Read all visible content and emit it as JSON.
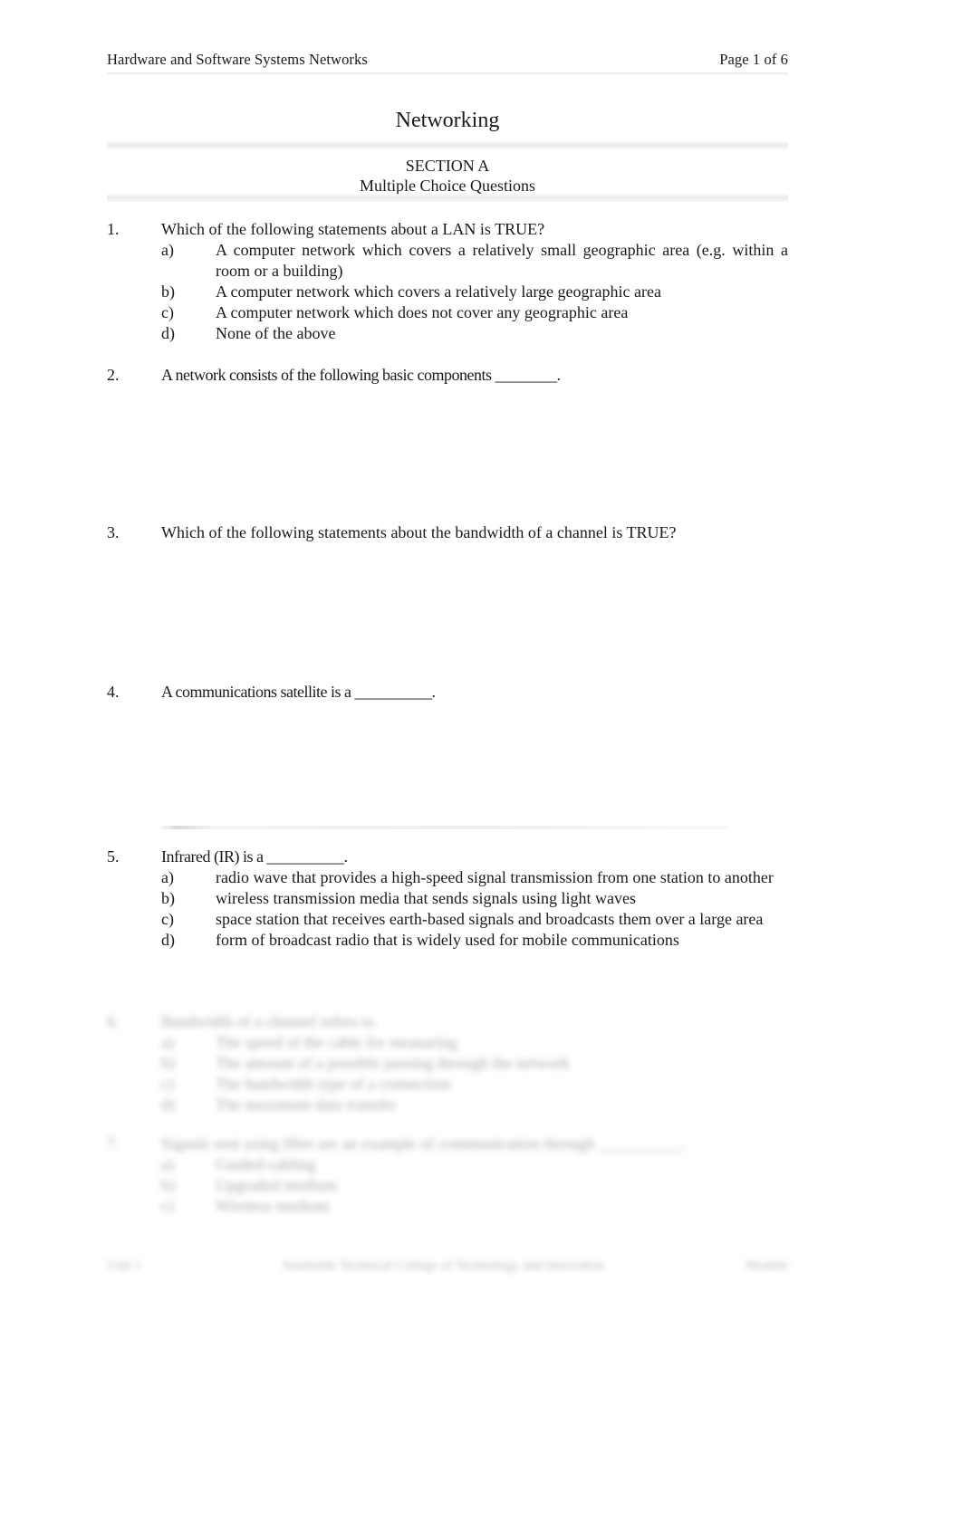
{
  "document": {
    "header": {
      "left": "Hardware and Software Systems Networks",
      "right": "Page 1 of 6"
    },
    "title": "Networking",
    "section": {
      "name": "SECTION A",
      "subtitle": "Multiple Choice Questions"
    }
  },
  "questions": [
    {
      "number": "1.",
      "text": "Which of the following statements about a LAN is TRUE?",
      "options": [
        {
          "letter": "a)",
          "text": "A computer network which covers a relatively small geographic area (e.g. within a room or a building)"
        },
        {
          "letter": "b)",
          "text": "A computer network which covers a relatively large geographic area"
        },
        {
          "letter": "c)",
          "text": "A computer network which does not cover any geographic area"
        },
        {
          "letter": "d)",
          "text": "None of the above"
        }
      ]
    },
    {
      "number": "2.",
      "text": "A network consists of the following basic components ________.",
      "options": []
    },
    {
      "number": "3.",
      "text": "Which of the following statements about the bandwidth of a channel is TRUE?",
      "options": []
    },
    {
      "number": "4.",
      "text": "A communications satellite is a __________.",
      "options": []
    },
    {
      "number": "5.",
      "text": "Infrared (IR) is a __________.",
      "options": [
        {
          "letter": "a)",
          "text": "radio wave that provides a high-speed signal transmission from one station to another"
        },
        {
          "letter": "b)",
          "text": "wireless transmission media that sends signals using light waves"
        },
        {
          "letter": "c)",
          "text": "space station that receives earth-based signals and broadcasts them over a large area"
        },
        {
          "letter": "d)",
          "text": "form of broadcast radio that is widely used for mobile communications"
        }
      ]
    }
  ],
  "obscured_questions": [
    {
      "number": "6.",
      "text": "Bandwidth of a channel refers to",
      "options": [
        {
          "letter": "a)",
          "text": "The speed of the cable for measuring"
        },
        {
          "letter": "b)",
          "text": "The amount of a possible passing through the network"
        },
        {
          "letter": "c)",
          "text": "The bandwidth type of a connection"
        },
        {
          "letter": "d)",
          "text": "The maximum data transfer"
        }
      ]
    },
    {
      "number": "7.",
      "text": "Signals sent using fibre are an example of communication through __________.",
      "options": [
        {
          "letter": "a)",
          "text": "Guided cabling"
        },
        {
          "letter": "b)",
          "text": "Upgraded medium"
        },
        {
          "letter": "c)",
          "text": "Wireless medium"
        }
      ]
    }
  ],
  "obscured_footer": {
    "left": "Unit 1",
    "center": "Southside Technical College of Technology and Innovation",
    "right": "Module"
  }
}
